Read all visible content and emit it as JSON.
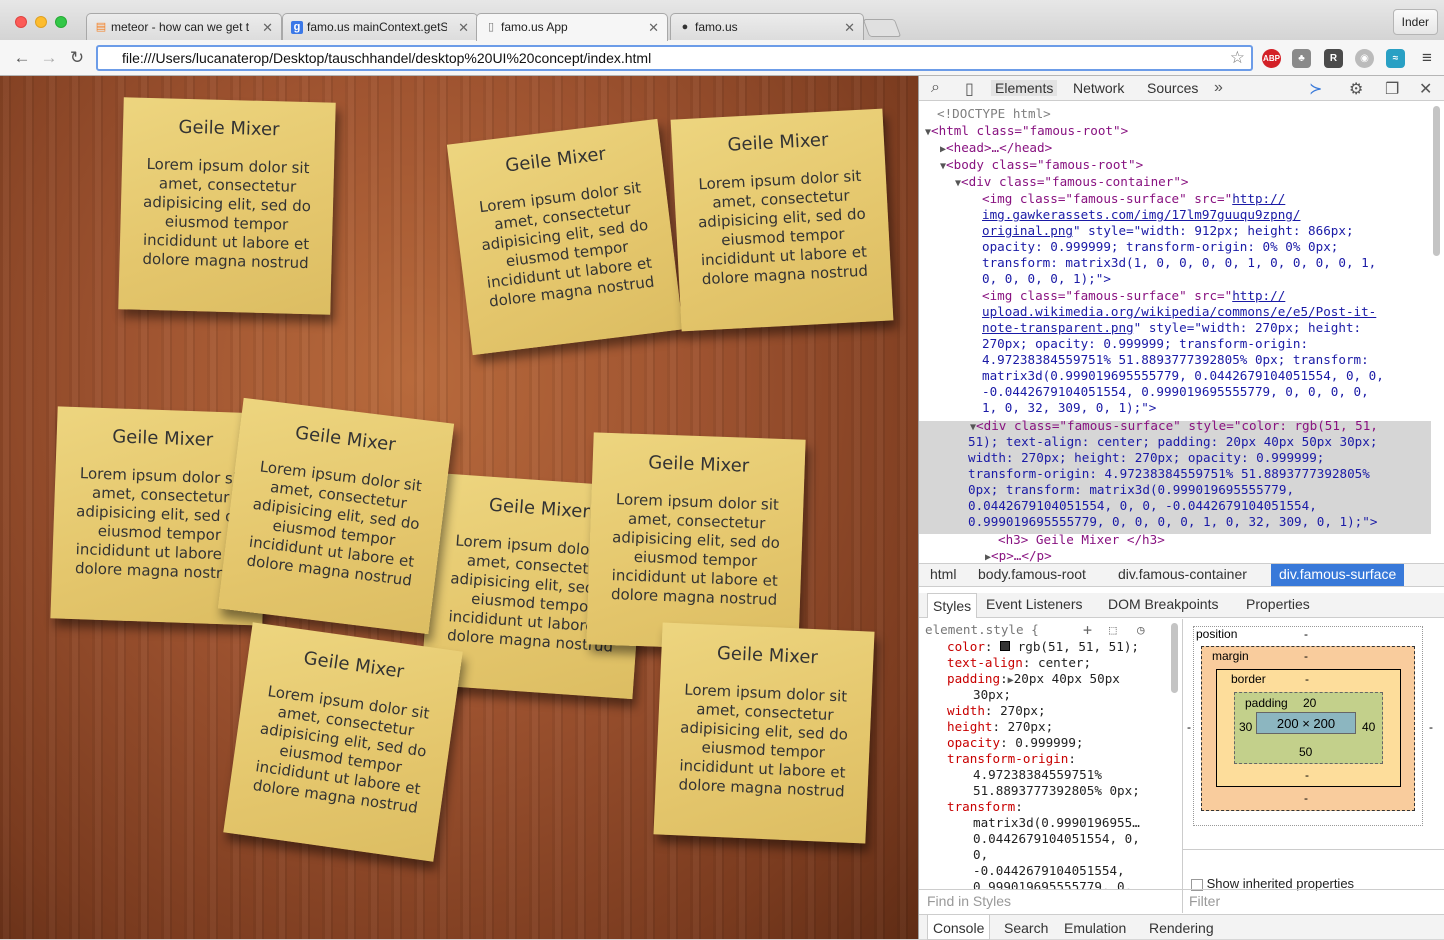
{
  "tabs": [
    {
      "title": "meteor - how can we get t",
      "icon": "stackoverflow-icon"
    },
    {
      "title": "famo.us mainContext.getSi",
      "icon": "google-icon"
    },
    {
      "title": "famo.us App",
      "icon": "document-icon"
    },
    {
      "title": "famo.us",
      "icon": "github-icon"
    }
  ],
  "profile": "Inder",
  "url": "file:///Users/lucanaterop/Desktop/tauschhandel/desktop%20UI%20concept/index.html",
  "extensions": [
    "ABP",
    "R"
  ],
  "note": {
    "heading": "Geile Mixer",
    "body": "Lorem ipsum dolor sit amet, consectetur adipisicing elit, sed do eiusmod tempor incididunt ut labore et dolore magna nostrud"
  },
  "devtools": {
    "tabs": [
      "Elements",
      "Network",
      "Sources"
    ],
    "dom": {
      "doctype": "<!DOCTYPE html>",
      "html_open": "<html class=\"famous-root\">",
      "head": "<head>…</head>",
      "body_open": "<body class=\"famous-root\">",
      "container_open": "<div class=\"famous-container\">",
      "img1": [
        "<img class=\"famous-surface\" src=\"",
        "http://",
        "img.gawkerassets.com/img/17lm97guuqu9zpng/",
        "original.png",
        "\" style=\"width: 912px; height: 866px;",
        "opacity: 0.999999; transform-origin: 0% 0% 0px;",
        "transform: matrix3d(1, 0, 0, 0, 0, 1, 0, 0, 0, 0, 1,",
        "0, 0, 0, 0, 1);\">"
      ],
      "img2": [
        "<img class=\"famous-surface\" src=\"",
        "http://",
        "upload.wikimedia.org/wikipedia/commons/e/e5/Post-it-",
        "note-transparent.png",
        "\" style=\"width: 270px; height:",
        "270px; opacity: 0.999999; transform-origin:",
        "4.97238384559751% 51.8893777392805% 0px; transform:",
        "matrix3d(0.999019695555779, 0.0442679104051554, 0, 0,",
        "-0.0442679104051554, 0.999019695555779, 0, 0, 0, 0,",
        "1, 0, 32, 309, 0, 1);\">"
      ],
      "div_sel": [
        "<div class=\"famous-surface\" style=\"color: rgb(51, 51,",
        "51); text-align: center; padding: 20px 40px 50px 30px;",
        "width: 270px; height: 270px; opacity: 0.999999;",
        "transform-origin: 4.97238384559751% 51.8893777392805%",
        "0px; transform: matrix3d(0.999019695555779,",
        "0.0442679104051554, 0, 0, -0.0442679104051554,",
        "0.999019695555779, 0, 0, 0, 0, 1, 0, 32, 309, 0, 1);\">"
      ],
      "h3": "<h3> Geile Mixer </h3>",
      "p": "<p>…</p>"
    },
    "breadcrumbs": [
      "html",
      "body.famous-root",
      "div.famous-container",
      "div.famous-surface"
    ],
    "style_tabs": [
      "Styles",
      "Event Listeners",
      "DOM Breakpoints",
      "Properties"
    ],
    "styles": {
      "selector": "element.style {",
      "color": "rgb(51, 51, 51);",
      "text_align": "center;",
      "padding": "20px 40px 50px",
      "padding2": "30px;",
      "width": "270px;",
      "height": "270px;",
      "opacity": "0.999999;",
      "origin1": "4.97238384559751%",
      "origin2": "51.8893777392805% 0px;",
      "t1": "matrix3d(0.9990196955…",
      "t2": "0.0442679104051554, 0,",
      "t3": "0,",
      "t4": "-0.0442679104051554,",
      "t5": "0.999019695555779, 0,"
    },
    "metrics": {
      "position": "position",
      "margin": "margin",
      "border": "border",
      "padding_label": "padding",
      "padding_top": "20",
      "padding_left": "30",
      "padding_right": "40",
      "padding_bottom": "50",
      "content": "200 × 200",
      "dash": "-"
    },
    "show_inherited": "Show inherited properties",
    "find_placeholder": "Find in Styles",
    "filter_placeholder": "Filter",
    "console_tabs": [
      "Console",
      "Search",
      "Emulation",
      "Rendering"
    ]
  }
}
